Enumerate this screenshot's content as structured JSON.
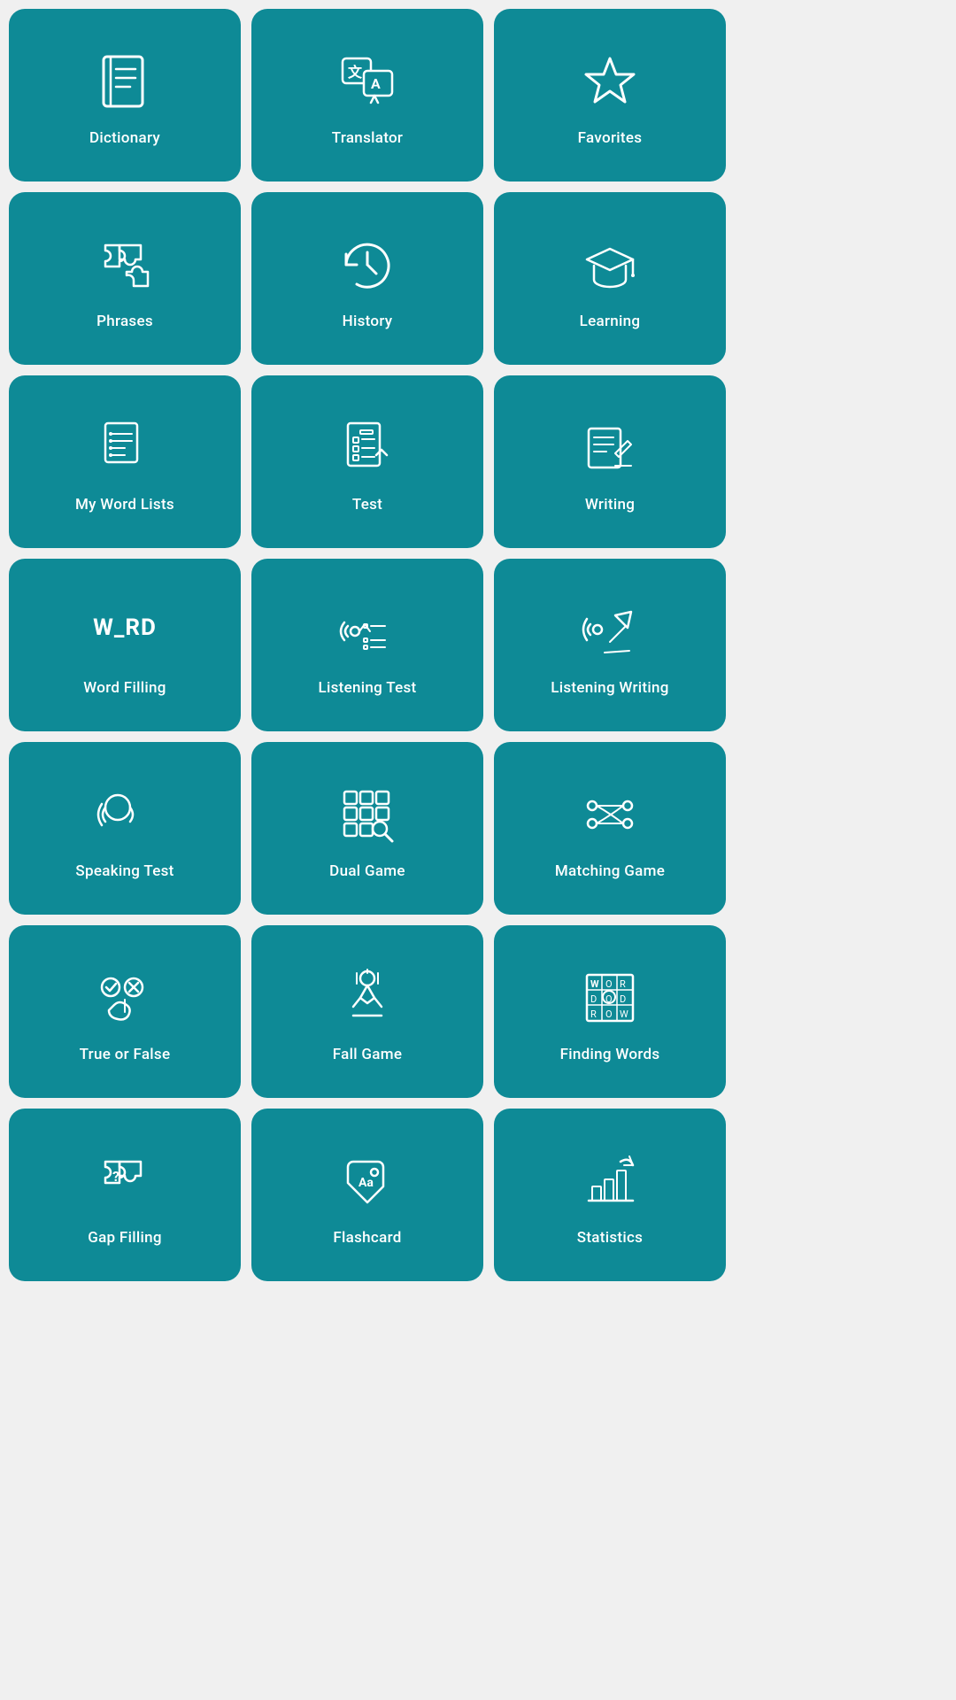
{
  "tiles": [
    {
      "id": "dictionary",
      "label": "Dictionary"
    },
    {
      "id": "translator",
      "label": "Translator"
    },
    {
      "id": "favorites",
      "label": "Favorites"
    },
    {
      "id": "phrases",
      "label": "Phrases"
    },
    {
      "id": "history",
      "label": "History"
    },
    {
      "id": "learning",
      "label": "Learning"
    },
    {
      "id": "my-word-lists",
      "label": "My Word Lists"
    },
    {
      "id": "test",
      "label": "Test"
    },
    {
      "id": "writing",
      "label": "Writing"
    },
    {
      "id": "word-filling",
      "label": "Word Filling"
    },
    {
      "id": "listening-test",
      "label": "Listening Test"
    },
    {
      "id": "listening-writing",
      "label": "Listening Writing"
    },
    {
      "id": "speaking-test",
      "label": "Speaking Test"
    },
    {
      "id": "dual-game",
      "label": "Dual Game"
    },
    {
      "id": "matching-game",
      "label": "Matching Game"
    },
    {
      "id": "true-or-false",
      "label": "True or False"
    },
    {
      "id": "fall-game",
      "label": "Fall Game"
    },
    {
      "id": "finding-words",
      "label": "Finding Words"
    },
    {
      "id": "gap-filling",
      "label": "Gap Filling"
    },
    {
      "id": "flashcard",
      "label": "Flashcard"
    },
    {
      "id": "statistics",
      "label": "Statistics"
    }
  ]
}
